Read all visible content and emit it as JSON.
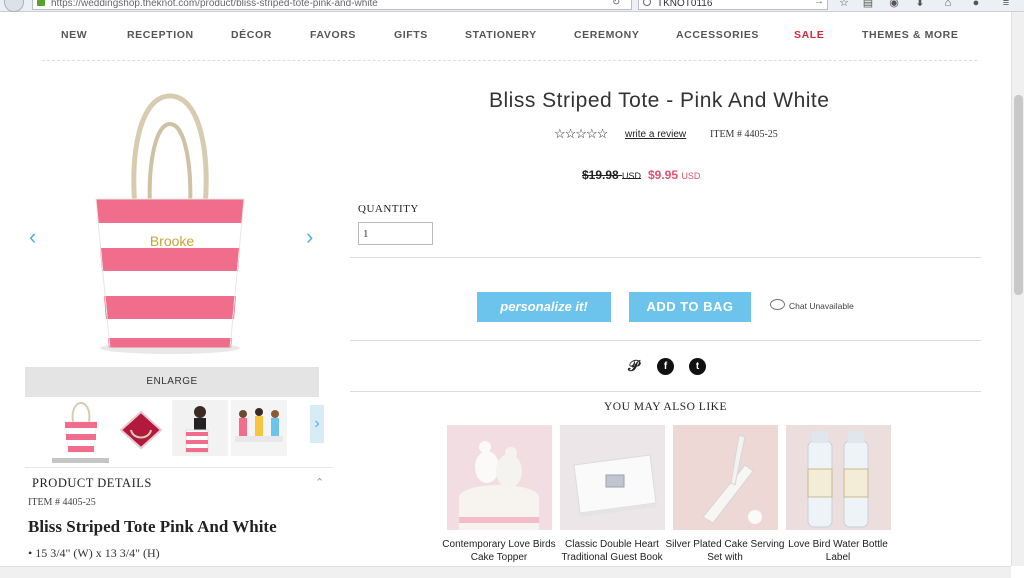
{
  "browser": {
    "url": "https://weddingshop.theknot.com/product/bliss-striped-tote-pink-and-white",
    "search_value": "TKNOT0116"
  },
  "nav": {
    "items": [
      "NEW",
      "RECEPTION",
      "DÉCOR",
      "FAVORS",
      "GIFTS",
      "STATIONERY",
      "CEREMONY",
      "ACCESSORIES",
      "SALE",
      "THEMES & MORE"
    ]
  },
  "gallery": {
    "tote_name_text": "Brooke",
    "prev_arrow": "‹",
    "next_arrow": "›",
    "enlarge_label": "ENLARGE",
    "thumb_next": "›"
  },
  "details": {
    "heading": "PRODUCT DETAILS",
    "toggle": "⌃",
    "item_no": "ITEM # 4405-25",
    "title": "Bliss Striped Tote Pink And White",
    "bullet": "• 15 3/4\" (W) x 13 3/4\" (H)"
  },
  "product": {
    "title": "Bliss Striped Tote - Pink And White",
    "stars": "☆☆☆☆☆",
    "review_link": "write a review",
    "item_no": "ITEM # 4405-25",
    "old_price": "$19.98",
    "old_currency": "USD",
    "new_price": "$9.95",
    "new_currency": "USD",
    "quantity_label": "QUANTITY",
    "quantity_value": "1",
    "personalize_label": "personalize it!",
    "add_to_bag_label": "ADD TO BAG",
    "chat_label": "Chat Unavailable"
  },
  "social": {
    "pinterest": "𝒫",
    "facebook": "f",
    "twitter": "t"
  },
  "recommendations": {
    "heading": "YOU MAY ALSO LIKE",
    "items": [
      {
        "name": "Contemporary Love Birds Cake Topper"
      },
      {
        "name": "Classic Double Heart Traditional Guest Book"
      },
      {
        "name": "Silver Plated Cake Serving Set with"
      },
      {
        "name": "Love Bird Water Bottle Label"
      }
    ]
  },
  "colors": {
    "accent_blue": "#6cc4ec",
    "sale_red": "#d9263c",
    "price_pink": "#e0526c"
  }
}
